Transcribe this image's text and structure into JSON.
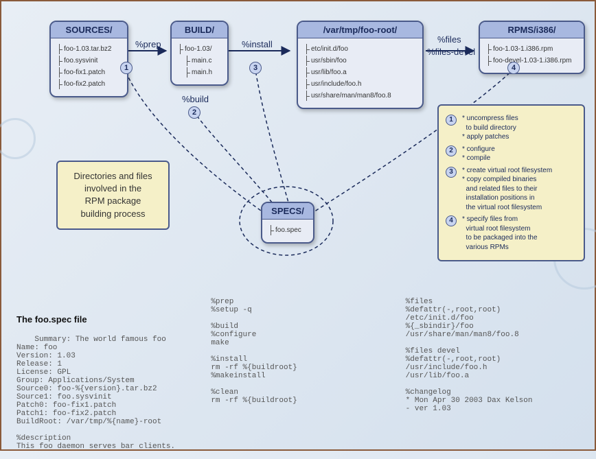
{
  "boxes": {
    "sources": {
      "title": "SOURCES/",
      "files": [
        "foo-1.03.tar.bz2",
        "foo.sysvinit",
        "foo-fix1.patch",
        "foo-fix2.patch"
      ]
    },
    "build": {
      "title": "BUILD/",
      "files": [
        "foo-1.03/",
        "main.c",
        "main.h"
      ]
    },
    "root": {
      "title": "/var/tmp/foo-root/",
      "files": [
        "etc/init.d/foo",
        "usr/sbin/foo",
        "usr/lib/foo.a",
        "usr/include/foo.h",
        "usr/share/man/man8/foo.8"
      ]
    },
    "rpms": {
      "title": "RPMS/i386/",
      "files": [
        "foo-1.03-1.i386.rpm",
        "foo-devel-1.03-1.i386.rpm"
      ]
    },
    "specs": {
      "title": "SPECS/",
      "files": [
        "foo.spec"
      ]
    }
  },
  "stages": {
    "prep": "%prep",
    "buildlbl": "%build",
    "install": "%install",
    "files": "%files",
    "filesdevel": "%files-devel"
  },
  "info": "Directories and files\ninvolved in the\nRPM package\nbuilding process",
  "legend": [
    "* uncompress files\n  to build directory\n* apply patches",
    "* configure\n* compile",
    "* create virtual root filesystem\n* copy compiled binaries\n  and related files to their\n  installation positions in\n  the virtual root filesystem",
    "* specify files from\n  virtual root filesystem\n  to be packaged into the\n  various RPMs"
  ],
  "spec_title": "The foo.spec file",
  "spec_col1": "Summary: The world famous foo\nName: foo\nVersion: 1.03\nRelease: 1\nLicense: GPL\nGroup: Applications/System\nSource0: foo-%{version}.tar.bz2\nSource1: foo.sysvinit\nPatch0: foo-fix1.patch\nPatch1: foo-fix2.patch\nBuildRoot: /var/tmp/%{name}-root\n\n%description\nThis foo daemon serves bar clients.",
  "spec_col2": "%prep\n%setup -q\n\n%build\n%configure\nmake\n\n%install\nrm -rf %{buildroot}\n%makeinstall\n\n%clean\nrm -rf %{buildroot}",
  "spec_col3": "%files\n%defattr(-,root,root)\n/etc/init.d/foo\n%{_sbindir}/foo\n/usr/share/man/man8/foo.8\n\n%files devel\n%defattr(-,root,root)\n/usr/include/foo.h\n/usr/lib/foo.a\n\n%changelog\n* Mon Apr 30 2003 Dax Kelson\n- ver 1.03"
}
